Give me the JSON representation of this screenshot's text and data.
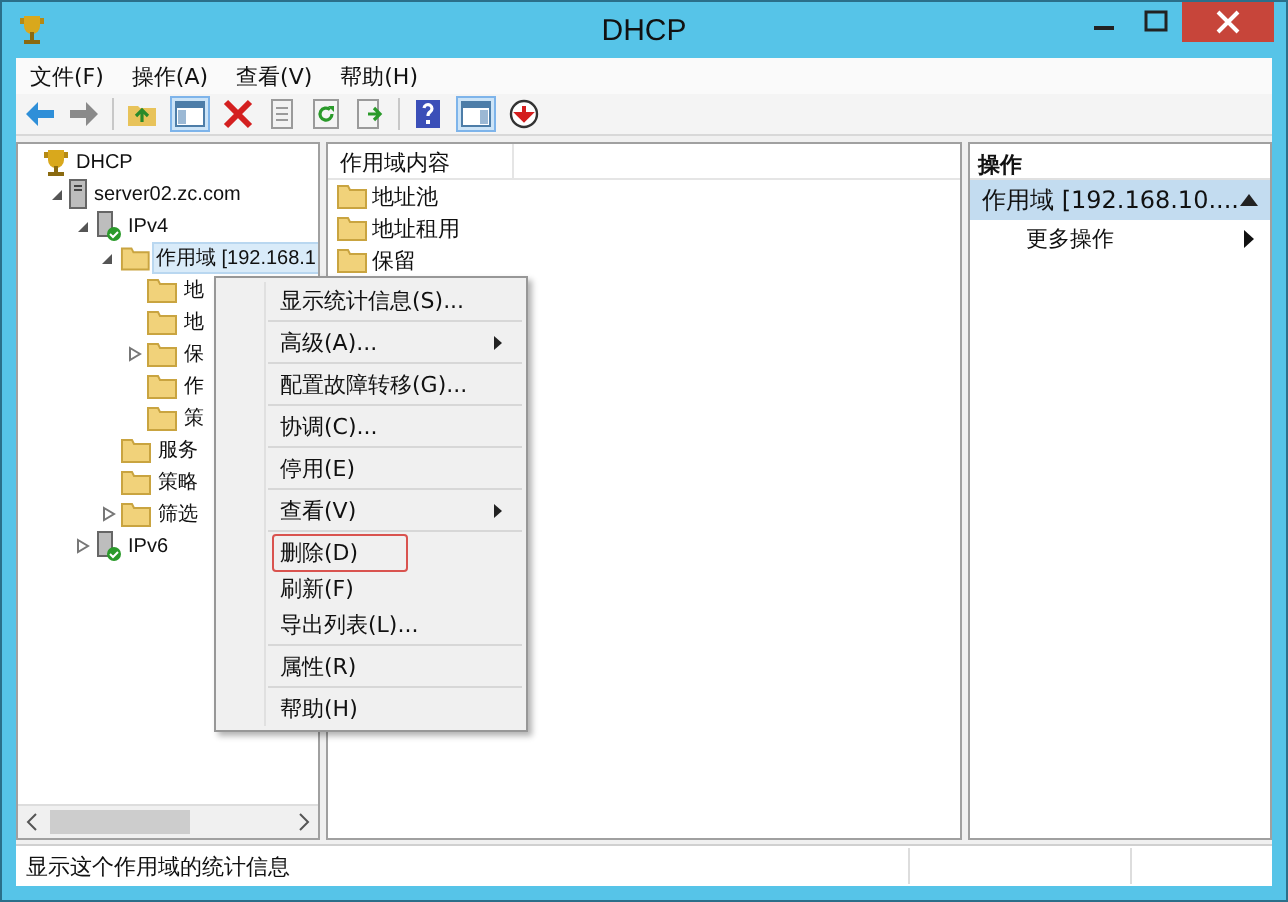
{
  "window": {
    "title": "DHCP"
  },
  "menu_bar": [
    "文件(F)",
    "操作(A)",
    "查看(V)",
    "帮助(H)"
  ],
  "tree": [
    {
      "label": "DHCP",
      "kind": "root",
      "selected": false,
      "children": [
        {
          "label": "server02.zc.com",
          "kind": "server",
          "selected": false,
          "expanded": true,
          "children": [
            {
              "label": "IPv4",
              "kind": "protocol",
              "selected": false,
              "expanded": true,
              "children": [
                {
                  "label": "作用域 [192.168.1",
                  "kind": "folder",
                  "selected": true,
                  "expanded": true,
                  "children": [
                    {
                      "label": "地",
                      "kind": "folder",
                      "selected": false
                    },
                    {
                      "label": "地",
                      "kind": "folder",
                      "selected": false
                    },
                    {
                      "label": "保",
                      "kind": "folder",
                      "selected": false,
                      "expanded": false
                    },
                    {
                      "label": "作",
                      "kind": "folder",
                      "selected": false
                    },
                    {
                      "label": "策",
                      "kind": "folder",
                      "selected": false
                    }
                  ]
                },
                {
                  "label": "服务",
                  "kind": "folder",
                  "selected": false
                },
                {
                  "label": "策略",
                  "kind": "folder",
                  "selected": false
                },
                {
                  "label": "筛选",
                  "kind": "folder",
                  "selected": false,
                  "expanded": false
                }
              ]
            },
            {
              "label": "IPv6",
              "kind": "protocol",
              "selected": false,
              "expanded": false
            }
          ]
        }
      ]
    }
  ],
  "content": {
    "column": "作用域内容",
    "items": [
      "地址池",
      "地址租用",
      "保留"
    ]
  },
  "actions": {
    "header": "操作",
    "section": "作用域 [192.168.10....",
    "items": [
      "更多操作"
    ]
  },
  "context_menu": [
    [
      {
        "label": "显示统计信息(S)...",
        "submenu": false,
        "highlighted": false
      }
    ],
    [
      {
        "label": "高级(A)...",
        "submenu": true,
        "highlighted": false
      }
    ],
    [
      {
        "label": "配置故障转移(G)...",
        "submenu": false,
        "highlighted": false
      }
    ],
    [
      {
        "label": "协调(C)...",
        "submenu": false,
        "highlighted": false
      }
    ],
    [
      {
        "label": "停用(E)",
        "submenu": false,
        "highlighted": false
      }
    ],
    [
      {
        "label": "查看(V)",
        "submenu": true,
        "highlighted": false
      }
    ],
    [
      {
        "label": "删除(D)",
        "submenu": false,
        "highlighted": true
      },
      {
        "label": "刷新(F)",
        "submenu": false,
        "highlighted": false
      },
      {
        "label": "导出列表(L)...",
        "submenu": false,
        "highlighted": false
      }
    ],
    [
      {
        "label": "属性(R)",
        "submenu": false,
        "highlighted": false
      }
    ],
    [
      {
        "label": "帮助(H)",
        "submenu": false,
        "highlighted": false
      }
    ]
  ],
  "status_bar": "显示这个作用域的统计信息"
}
